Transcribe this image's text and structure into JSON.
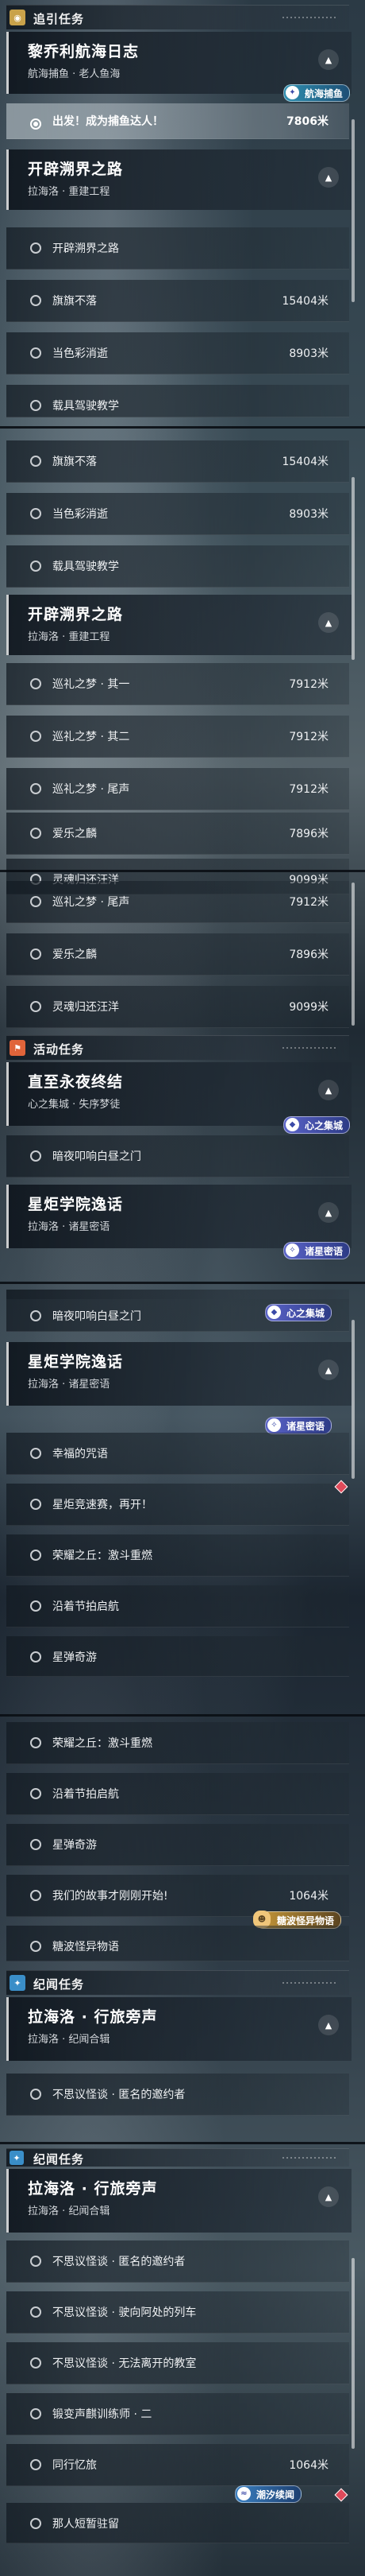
{
  "sections": {
    "guide": "追引任务",
    "event": "活动任务",
    "chronicle": "纪闻任务"
  },
  "quests": {
    "lizhou": {
      "title": "黎乔利航海日志",
      "sub": "航海捕鱼 · 老人鱼海",
      "tag": "航海捕鱼"
    },
    "open": {
      "title": "开辟溯界之路",
      "sub": "拉海洛 · 重建工程"
    },
    "night": {
      "title": "直至永夜终结",
      "sub": "心之集城 · 失序梦徒",
      "tag": "心之集城"
    },
    "academy": {
      "title": "星炬学院逸话",
      "sub": "拉海洛 · 诸星密语",
      "tag": "诸星密语"
    },
    "lahailuo": {
      "title": "拉海洛 · 行旅旁声",
      "sub": "拉海洛 · 纪闻合辑"
    }
  },
  "items": {
    "catch": {
      "label": "出发！成为捕鱼达人！",
      "dist": "7806米"
    },
    "open_road": "开辟溯界之路",
    "flag": {
      "label": "旗旗不落",
      "dist": "15404米"
    },
    "rainbow": {
      "label": "当色彩消逝",
      "dist": "8903米"
    },
    "vehicle": "载具驾驶教学",
    "dream1": {
      "label": "巡礼之梦 · 其一",
      "dist": "7912米"
    },
    "dream2": {
      "label": "巡礼之梦 · 其二",
      "dist": "7912米"
    },
    "dream_end": {
      "label": "巡礼之梦 · 尾声",
      "dist": "7912米"
    },
    "love": {
      "label": "爱乐之麟",
      "dist": "7896米"
    },
    "soul": {
      "label": "灵魂归还汪洋",
      "dist": "9099米"
    },
    "darkgate": "暗夜叩响白昼之门",
    "curse": "幸福的咒语",
    "starbattle": "星炬竞速赛，再开！",
    "glory": "荣耀之丘：激斗重燃",
    "festival": "沿着节拍启航",
    "starplay": "星弹奇游",
    "story": {
      "label": "我们的故事才刚刚开始!",
      "dist": "1064米"
    },
    "candy": "糖波怪异物语",
    "invite": "不思议怪谈 · 匿名的邀约者",
    "train": "不思议怪谈 · 驶向阿处的列车",
    "classroom": "不思议怪谈 · 无法离开的教室",
    "bell": "锻变声麒训练师 · 二",
    "companion": {
      "label": "同行忆旅",
      "dist": "1064米"
    },
    "witch": "那人短暂驻留"
  },
  "tags": {
    "heart": "心之集城",
    "stars": "诸星密语",
    "candy": "糖波怪异物语",
    "tide": "潮汐续闻"
  },
  "colors": {
    "guide_badge": "#c9a24a",
    "event_badge": "#e0643a",
    "chronicle_badge": "#3a8ec8"
  }
}
